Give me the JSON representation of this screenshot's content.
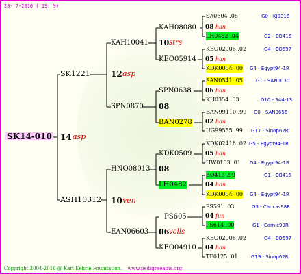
{
  "date": "28- 7-2016 ( 19: 9)",
  "footer": {
    "copyright": "Copyright 2004-2016 @ Karl Kehrle Foundation.",
    "url": "www.pedigreeapis.org"
  },
  "root": {
    "label": "SK14-010",
    "score": "14",
    "tag": "asp"
  },
  "gen1": [
    {
      "label": "SK1221",
      "score": "12",
      "tag": "asp"
    },
    {
      "label": "ASH10312",
      "score": "10",
      "tag": "ven"
    }
  ],
  "gen2": [
    {
      "label": "KAH10041",
      "score": "10",
      "tag": "strs"
    },
    {
      "label": "SPN0870",
      "score": "08",
      "tag": ""
    },
    {
      "label": "HNO08013",
      "score": "08",
      "tag": ""
    },
    {
      "label": "EAN06603",
      "score": "06",
      "tag": "volls"
    }
  ],
  "gen3": [
    {
      "label": "KAH08080",
      "score": "08",
      "tag": "han"
    },
    {
      "label": "KEO05914",
      "score": "05",
      "tag": "han"
    },
    {
      "label": "SPN0638",
      "score": "06",
      "tag": "han"
    },
    {
      "label": "BAN0278",
      "score": "02",
      "tag": "han"
    },
    {
      "label": "KDK0509",
      "score": "05",
      "tag": "han"
    },
    {
      "label": "LH0482",
      "score": "04",
      "tag": "han"
    },
    {
      "label": "PS605",
      "score": "04",
      "tag": "fun"
    },
    {
      "label": "KEO04910",
      "score": "04",
      "tag": "han"
    }
  ],
  "gen4": [
    {
      "label": "SA0604 .06",
      "ref": "G0 - KJ0316"
    },
    {
      "label": "LH0482 .04",
      "ref": "G2 - EO415"
    },
    {
      "label": "KEO02906 .02",
      "ref": "G4 - EO597"
    },
    {
      "label": "KDK0004 .00",
      "ref": "G4 - Egypt94-1R"
    },
    {
      "label": "SAN0541 .05",
      "ref": "G1 - SAN0030"
    },
    {
      "label": "KH0354 .03",
      "ref": "G10 - 344-13"
    },
    {
      "label": "BAN99110 .99",
      "ref": "G0 - SAN9656"
    },
    {
      "label": "UG99555 .99",
      "ref": "G17 - Sinop62R"
    },
    {
      "label": "KDK02418 .02",
      "ref": "G5 - Egypt94-1R"
    },
    {
      "label": "HW0103 .01",
      "ref": "G4 - Egypt94-1R"
    },
    {
      "label": "EO413 .99",
      "ref": "G1 - EO415"
    },
    {
      "label": "KDK0004 .00",
      "ref": "G4 - Egypt94-1R"
    },
    {
      "label": "PS591 .03",
      "ref": "G3 - Caucas98R"
    },
    {
      "label": "PS614 .00",
      "ref": "G1 - Carnic99R"
    },
    {
      "label": "KEO02906 .02",
      "ref": "G4 - EO597"
    },
    {
      "label": "TF0125 .01",
      "ref": "G19 - Sinop62R"
    }
  ]
}
